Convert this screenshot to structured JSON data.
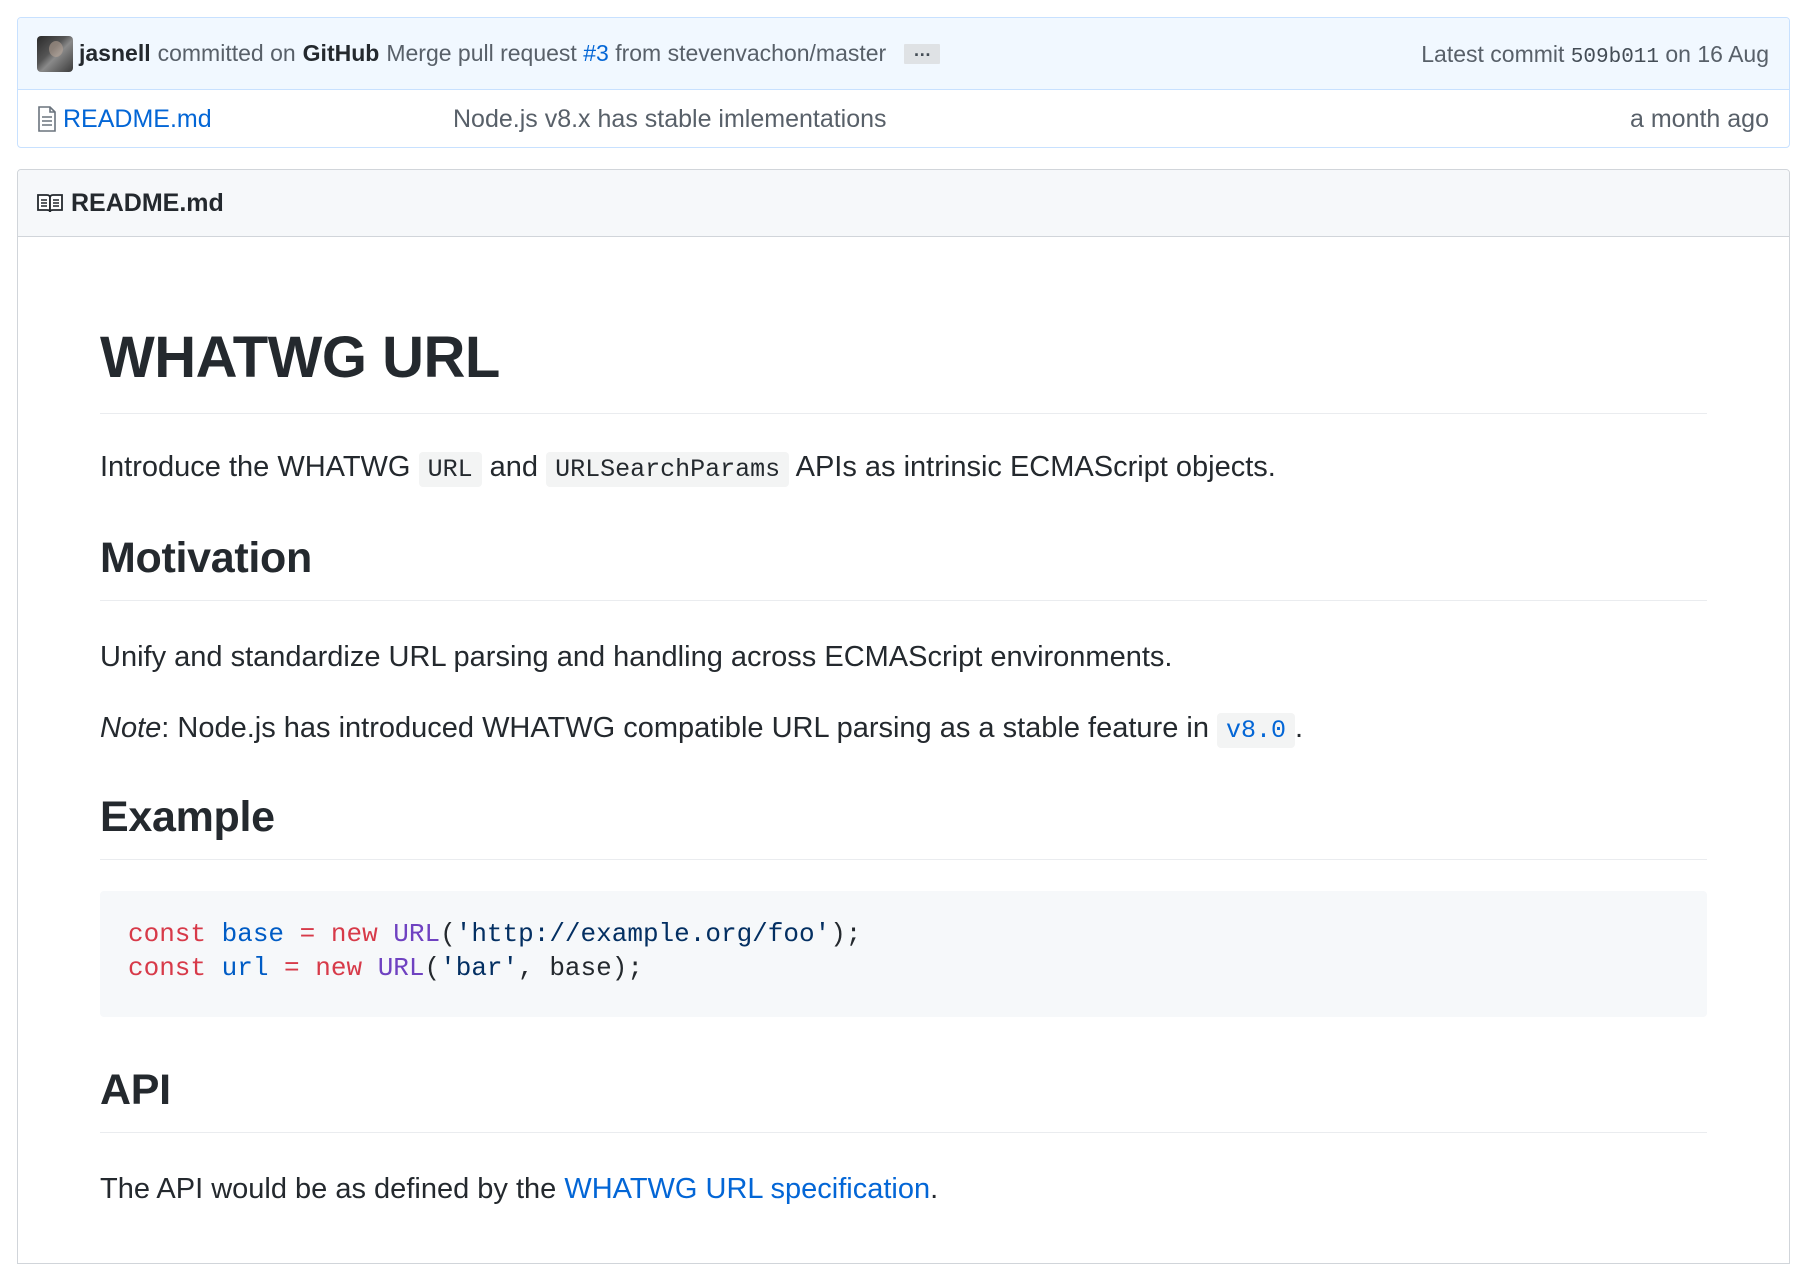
{
  "commit": {
    "author": "jasnell",
    "committed_on": "committed on",
    "platform": "GitHub",
    "message_prefix": "Merge pull request",
    "pr_link": "#3",
    "message_suffix": "from stevenvachon/master",
    "ellipsis": "…",
    "latest_label": "Latest commit",
    "hash": "509b011",
    "date_text": "on 16 Aug"
  },
  "file": {
    "name": "README.md",
    "message": "Node.js v8.x has stable imlementations",
    "age": "a month ago"
  },
  "readme": {
    "header": "README.md",
    "title": "WHATWG URL",
    "intro": {
      "part1": "Introduce the WHATWG",
      "code1": "URL",
      "part2": "and",
      "code2": "URLSearchParams",
      "part3": "APIs as intrinsic ECMAScript objects."
    },
    "motivation": {
      "heading": "Motivation",
      "text": "Unify and standardize URL parsing and handling across ECMAScript environments.",
      "note_em": "Note",
      "note_text": ": Node.js has introduced WHATWG compatible URL parsing as a stable feature in",
      "note_code": "v8.0",
      "note_end": "."
    },
    "example": {
      "heading": "Example",
      "line1": {
        "kw1": "const",
        "var": "base",
        "eq": "=",
        "kw2": "new",
        "fn": "URL",
        "open": "(",
        "str": "'http://example.org/foo'",
        "close": ");"
      },
      "line2": {
        "kw1": "const",
        "var": "url",
        "eq": "=",
        "kw2": "new",
        "fn": "URL",
        "open": "(",
        "str": "'bar'",
        "rest": ", base);"
      }
    },
    "api": {
      "heading": "API",
      "text": "The API would be as defined by the",
      "link": "WHATWG URL specification",
      "end": "."
    }
  },
  "colors": {
    "link": "#0366d6",
    "keyword": "#d73a49",
    "variable": "#005cc5",
    "function": "#6f42c1",
    "string": "#032f62",
    "commit_bar_bg": "#f1f8ff"
  }
}
